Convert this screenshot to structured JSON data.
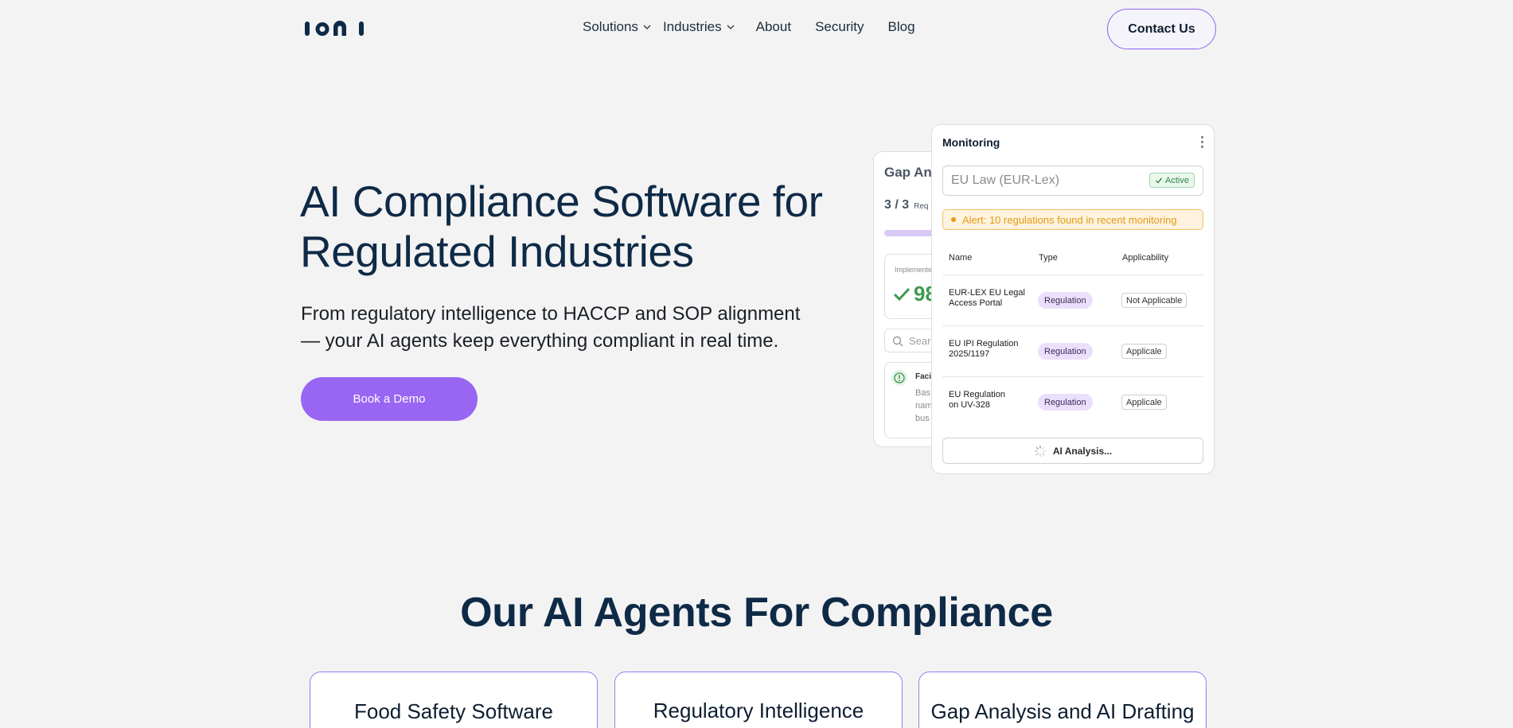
{
  "brand": {
    "logo_text": "IONI"
  },
  "nav": {
    "items": [
      {
        "label": "Solutions",
        "dropdown": true
      },
      {
        "label": "Industries",
        "dropdown": true
      },
      {
        "label": "About",
        "dropdown": false
      },
      {
        "label": "Security",
        "dropdown": false
      },
      {
        "label": "Blog",
        "dropdown": false
      }
    ],
    "contact_label": "Contact Us"
  },
  "hero": {
    "title_line1": "AI Compliance Software for",
    "title_line2": "Regulated Industries",
    "subtitle_line1": "From regulatory intelligence to HACCP and SOP alignment",
    "subtitle_line2": "— your AI agents keep everything compliant in real time.",
    "cta_label": "Book a Demo"
  },
  "gap_card": {
    "title": "Gap Ana",
    "count": "3 / 3",
    "count_suffix": "Req",
    "implemented_label": "Implemente",
    "implemented_value": "98",
    "search_placeholder": "Searc",
    "item_title": "Faci",
    "item_text_lines": [
      "Bas",
      "nam",
      "bus"
    ]
  },
  "monitoring": {
    "title": "Monitoring",
    "source": "EU Law (EUR-Lex)",
    "status": "Active",
    "alert": "Alert: 10 regulations found in recent monitoring",
    "columns": {
      "name": "Name",
      "type": "Type",
      "applicability": "Applicability"
    },
    "rows": [
      {
        "name_line1": "EUR-LEX EU Legal",
        "name_line2": "Access Portal",
        "type": "Regulation",
        "applicability": "Not Applicable"
      },
      {
        "name_line1": "EU IPI Regulation",
        "name_line2": "2025/1197",
        "type": "Regulation",
        "applicability": "Applicale"
      },
      {
        "name_line1": "EU Regulation",
        "name_line2": "on UV-328",
        "type": "Regulation",
        "applicability": "Applicale"
      }
    ],
    "ai_button": "AI Analysis..."
  },
  "agents_section": {
    "title": "Our AI Agents For Compliance",
    "cards": [
      {
        "title": "Food Safety Software"
      },
      {
        "title": "Regulatory Intelligence"
      },
      {
        "title": "Gap Analysis and AI Drafting"
      }
    ]
  },
  "colors": {
    "brand_navy": "#0e2a47",
    "accent_purple": "#9966f3",
    "success_green": "#3c9a4d",
    "alert_orange": "#e69a14"
  }
}
